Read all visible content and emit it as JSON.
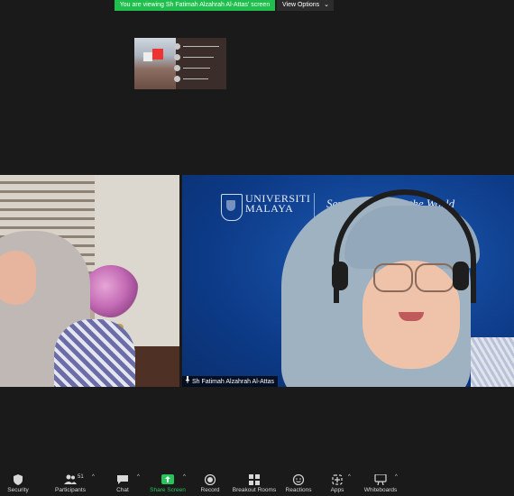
{
  "banner": {
    "share_text": "You are viewing Sh Fatimah Alzahrah Al-Attas' screen",
    "view_options_label": "View Options",
    "colors": {
      "banner_green": "#1fbf4d",
      "accent_green": "#28c35a"
    }
  },
  "videos": {
    "right": {
      "university_line1": "UNIVERSITI",
      "university_line2": "MALAYA",
      "tagline": "Serving ... acting the World",
      "participant_name": "Sh Fatimah Alzahrah Al-Attas"
    }
  },
  "toolbar": {
    "items": [
      {
        "label": "Security",
        "icon": "shield-icon"
      },
      {
        "label": "Participants",
        "icon": "participants-icon",
        "count": "51"
      },
      {
        "label": "Chat",
        "icon": "chat-icon"
      },
      {
        "label": "Share Screen",
        "icon": "share-screen-icon"
      },
      {
        "label": "Record",
        "icon": "record-icon"
      },
      {
        "label": "Breakout Rooms",
        "icon": "breakout-rooms-icon"
      },
      {
        "label": "Reactions",
        "icon": "reactions-icon"
      },
      {
        "label": "Apps",
        "icon": "apps-icon"
      },
      {
        "label": "Whiteboards",
        "icon": "whiteboard-icon"
      }
    ]
  }
}
